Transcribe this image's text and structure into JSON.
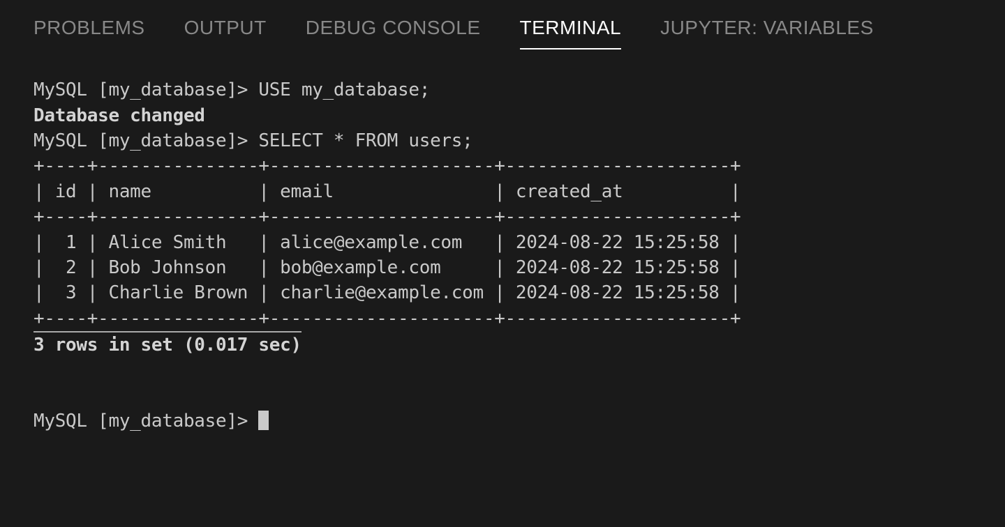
{
  "tabs": [
    {
      "label": "PROBLEMS",
      "active": false
    },
    {
      "label": "OUTPUT",
      "active": false
    },
    {
      "label": "DEBUG CONSOLE",
      "active": false
    },
    {
      "label": "TERMINAL",
      "active": true
    },
    {
      "label": "JUPYTER: VARIABLES",
      "active": false
    }
  ],
  "terminal": {
    "prompt": "MySQL [my_database]> ",
    "line1_cmd": "USE my_database;",
    "line2_msg": "Database changed",
    "line3_cmd": "SELECT * FROM users;",
    "table_border": "+----+---------------+---------------------+---------------------+",
    "table_header": "| id | name          | email               | created_at          |",
    "row1": "|  1 | Alice Smith   | alice@example.com   | 2024-08-22 15:25:58 |",
    "row2": "|  2 | Bob Johnson   | bob@example.com     | 2024-08-22 15:25:58 |",
    "row3": "|  3 | Charlie Brown | charlie@example.com | 2024-08-22 15:25:58 |",
    "summary": "3 rows in set (0.017 sec)",
    "final_prompt": "MySQL [my_database]> "
  },
  "chart_data": {
    "type": "table",
    "title": "users",
    "columns": [
      "id",
      "name",
      "email",
      "created_at"
    ],
    "rows": [
      {
        "id": 1,
        "name": "Alice Smith",
        "email": "alice@example.com",
        "created_at": "2024-08-22 15:25:58"
      },
      {
        "id": 2,
        "name": "Bob Johnson",
        "email": "bob@example.com",
        "created_at": "2024-08-22 15:25:58"
      },
      {
        "id": 3,
        "name": "Charlie Brown",
        "email": "charlie@example.com",
        "created_at": "2024-08-22 15:25:58"
      }
    ],
    "row_count": 3,
    "elapsed_sec": 0.017
  }
}
